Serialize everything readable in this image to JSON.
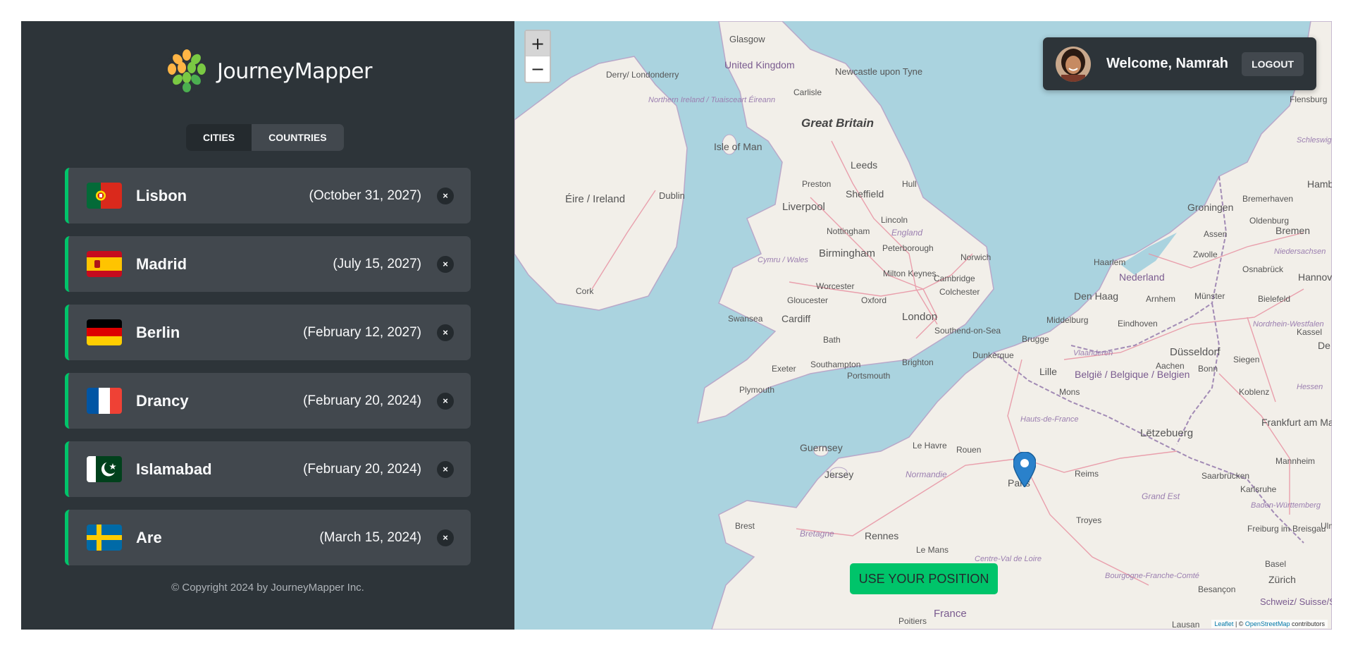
{
  "brand": {
    "name": "JourneyMapper"
  },
  "tabs": [
    {
      "label": "CITIES",
      "active": true
    },
    {
      "label": "COUNTRIES",
      "active": false
    }
  ],
  "cities": [
    {
      "name": "Lisbon",
      "date": "(October 31, 2027)",
      "flag": "portugal-flag"
    },
    {
      "name": "Madrid",
      "date": "(July 15, 2027)",
      "flag": "spain-flag"
    },
    {
      "name": "Berlin",
      "date": "(February 12, 2027)",
      "flag": "germany-flag"
    },
    {
      "name": "Drancy",
      "date": "(February 20, 2024)",
      "flag": "france-flag"
    },
    {
      "name": "Islamabad",
      "date": "(February 20, 2024)",
      "flag": "pakistan-flag"
    },
    {
      "name": "Are",
      "date": "(March 15, 2024)",
      "flag": "sweden-flag"
    }
  ],
  "delete_symbol": "×",
  "footer": {
    "copyright": "© Copyright 2024 by JourneyMapper Inc."
  },
  "map": {
    "zoom_in": "+",
    "zoom_out": "−",
    "use_position": "USE YOUR POSITION",
    "attribution": {
      "leaflet": "Leaflet",
      "sep": " | © ",
      "osm": "OpenStreetMap",
      "suffix": " contributors"
    },
    "labels": {
      "glasgow": "Glasgow",
      "uk": "United Kingdom",
      "newcastle": "Newcastle upon Tyne",
      "derry": "Derry/ Londonderry",
      "ni": "Northern Ireland / Tuaisceart Éireann",
      "carlisle": "Carlisle",
      "gb": "Great Britain",
      "iom": "Isle of Man",
      "eire": "Éire / Ireland",
      "dublin": "Dublin",
      "leeds": "Leeds",
      "preston": "Preston",
      "hull": "Hull",
      "sheffield": "Sheffield",
      "liverpool": "Liverpool",
      "nottingham": "Nottingham",
      "lincoln": "Lincoln",
      "england": "England",
      "birmingham": "Birmingham",
      "peterborough": "Peterborough",
      "norwich": "Norwich",
      "cymru": "Cymru / Wales",
      "worcester": "Worcester",
      "milton": "Milton Keynes",
      "cambridge": "Cambridge",
      "cork": "Cork",
      "gloucester": "Gloucester",
      "oxford": "Oxford",
      "colchester": "Colchester",
      "swansea": "Swansea",
      "cardiff": "Cardiff",
      "london": "London",
      "southend": "Southend-on-Sea",
      "bath": "Bath",
      "exeter": "Exeter",
      "southampton": "Southampton",
      "brighton": "Brighton",
      "portsmouth": "Portsmouth",
      "plymouth": "Plymouth",
      "dunkerque": "Dunkerque",
      "lille": "Lille",
      "brugge": "Brugge",
      "middelburg": "Middelburg",
      "denhaag": "Den Haag",
      "haarlem": "Haarlem",
      "nederland": "Nederland",
      "arnhem": "Arnhem",
      "eindhoven": "Eindhoven",
      "groningen": "Groningen",
      "assen": "Assen",
      "zwolle": "Zwolle",
      "oldenburg": "Oldenburg",
      "bremen": "Bremen",
      "bremerhaven": "Bremerhaven",
      "flensburg": "Flensburg",
      "schleswig": "Schleswig-Holstein",
      "hamb": "Hamb",
      "hannov": "Hannov",
      "niedersachsen": "Niedersachsen",
      "osnabruck": "Osnabrück",
      "bielefeld": "Bielefeld",
      "munster": "Münster",
      "nordrhein": "Nordrhein-Westfalen",
      "kassel": "Kassel",
      "dusseldorf": "Düsseldorf",
      "aachen": "Aachen",
      "bonn": "Bonn",
      "siegen": "Siegen",
      "de": "De",
      "belgie": "België / Belgique / Belgien",
      "vlaanderen": "Vlaanderen",
      "mons": "Mons",
      "koblenz": "Koblenz",
      "hessen": "Hessen",
      "letzebuerg": "Lëtzebuerg",
      "frankfurt": "Frankfurt am Main",
      "mannheim": "Mannheim",
      "hautsdefrance": "Hauts-de-France",
      "guernsey": "Guernsey",
      "jersey": "Jersey",
      "lehavre": "Le Havre",
      "rouen": "Rouen",
      "normandie": "Normandie",
      "paris": "Paris",
      "reims": "Reims",
      "grandest": "Grand Est",
      "saarbrucken": "Saarbrücken",
      "karlsruhe": "Karlsruhe",
      "baden": "Baden-Württemberg",
      "brest": "Brest",
      "bretagne": "Bretagne",
      "rennes": "Rennes",
      "lemans": "Le Mans",
      "troyes": "Troyes",
      "freiburg": "Freiburg im Breisgau",
      "ulm": "Ulm",
      "centre": "Centre-Val de Loire",
      "bourgogne": "Bourgogne-Franche-Comté",
      "basel": "Basel",
      "zurich": "Zürich",
      "besancon": "Besançon",
      "schweiz": "Schweiz/ Suisse/Svizzera/",
      "france": "France",
      "poitiers": "Poitiers",
      "lausan": "Lausan"
    }
  },
  "user": {
    "welcome": "Welcome, Namrah",
    "logout": "LOGOUT"
  },
  "colors": {
    "accent": "#00c46a",
    "panel": "#2d3439",
    "card": "#42484e",
    "dark": "#242a2e",
    "marker": "#2a81cb",
    "water": "#aad3df",
    "land": "#f2efe9"
  }
}
